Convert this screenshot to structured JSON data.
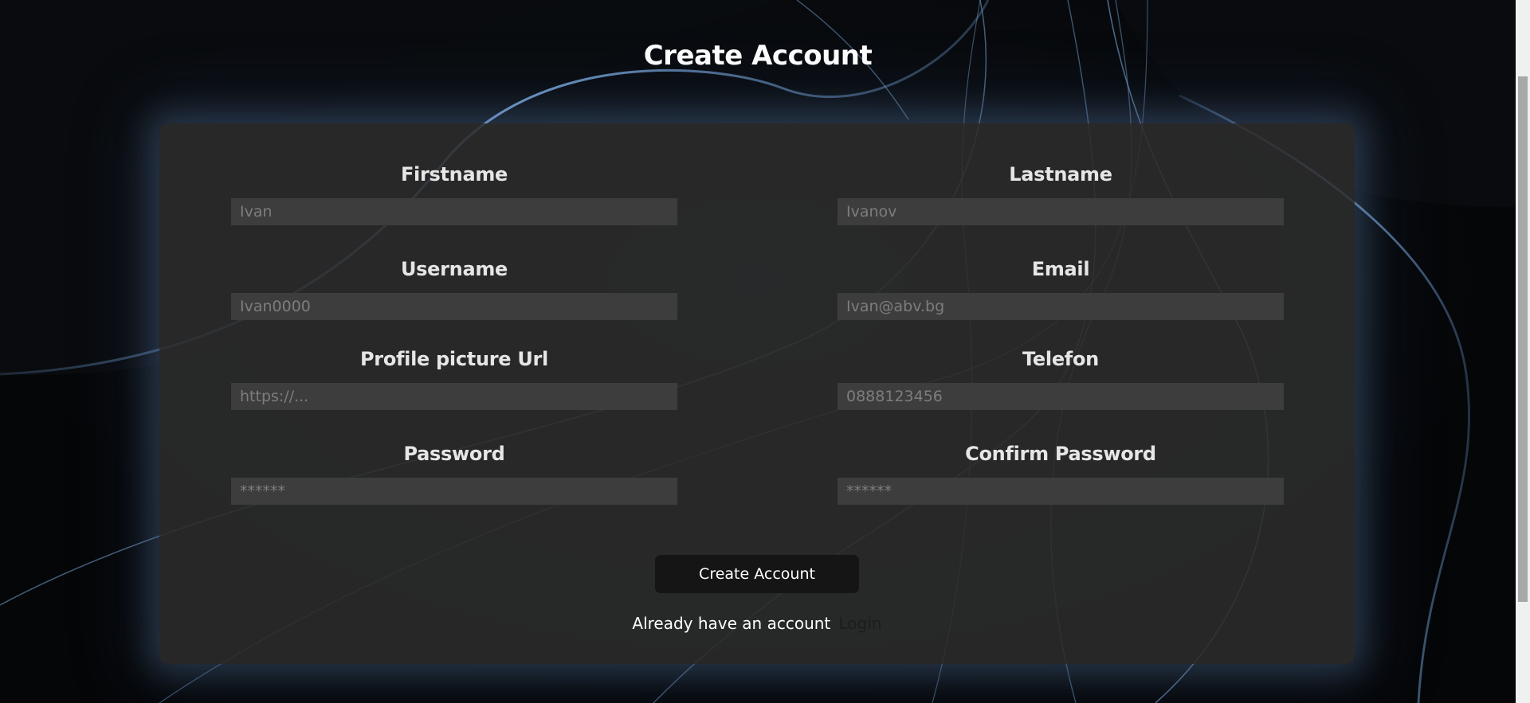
{
  "page": {
    "title": "Create Account"
  },
  "form": {
    "firstname": {
      "label": "Firstname",
      "placeholder": "Ivan"
    },
    "lastname": {
      "label": "Lastname",
      "placeholder": "Ivanov"
    },
    "username": {
      "label": "Username",
      "placeholder": "Ivan0000"
    },
    "email": {
      "label": "Email",
      "placeholder": "Ivan@abv.bg"
    },
    "profile_picture": {
      "label": "Profile picture Url",
      "placeholder": "https://..."
    },
    "telefon": {
      "label": "Telefon",
      "placeholder": "0888123456"
    },
    "password": {
      "label": "Password",
      "placeholder": "******"
    },
    "confirm_password": {
      "label": "Confirm Password",
      "placeholder": "******"
    },
    "submit_label": "Create Account",
    "login_prompt": "Already have an account",
    "login_link": "Login"
  },
  "colors": {
    "background": "#050608",
    "card": "#2c2c2c",
    "input": "#3d3d3d",
    "button": "#151515",
    "curve_accent": "#6f9fd6"
  }
}
